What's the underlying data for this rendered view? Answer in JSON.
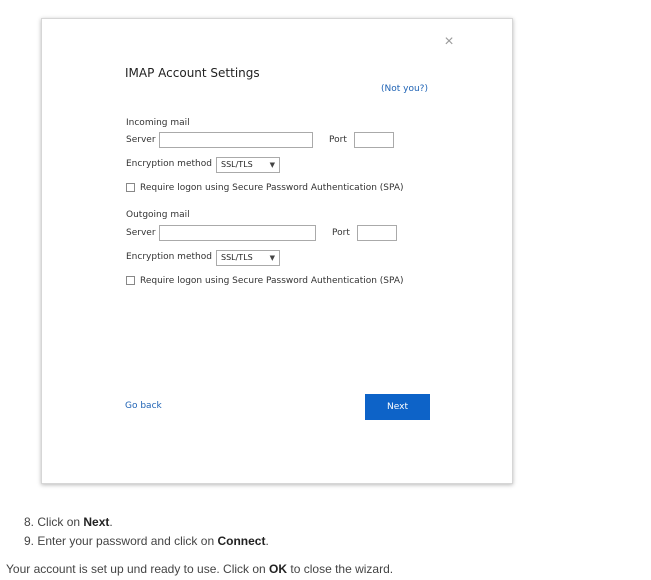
{
  "dialog": {
    "close_glyph": "×",
    "title": "IMAP Account Settings",
    "not_you": "(Not you?)",
    "incoming": {
      "heading": "Incoming mail",
      "server_label": "Server",
      "server_value": "",
      "port_label": "Port",
      "port_value": "",
      "encryption_label": "Encryption method",
      "encryption_value": "SSL/TLS",
      "spa_label": "Require logon using Secure Password Authentication (SPA)",
      "spa_checked": false
    },
    "outgoing": {
      "heading": "Outgoing mail",
      "server_label": "Server",
      "server_value": "",
      "port_label": "Port",
      "port_value": "",
      "encryption_label": "Encryption method",
      "encryption_value": "SSL/TLS",
      "spa_label": "Require logon using Secure Password Authentication (SPA)",
      "spa_checked": false
    },
    "go_back": "Go back",
    "next": "Next"
  },
  "instructions": {
    "step8": {
      "num": "8.",
      "pre": "Click on ",
      "bold": "Next",
      "post": "."
    },
    "step9": {
      "num": "9.",
      "pre": "Enter your password and click on ",
      "bold": "Connect",
      "post": "."
    },
    "final": {
      "pre": "Your account is set up und ready to use. Click on ",
      "bold": "OK",
      "post": " to close the wizard."
    }
  }
}
